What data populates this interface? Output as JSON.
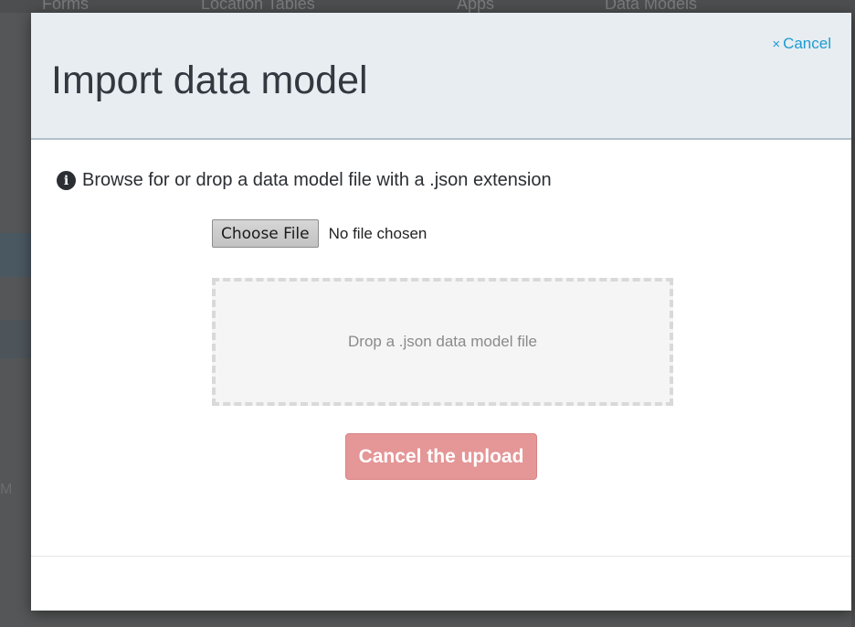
{
  "background": {
    "nav_items": [
      "Forms",
      "Location Tables",
      "Apps",
      "Data Models"
    ],
    "side_text": "M"
  },
  "modal": {
    "title": "Import data model",
    "close_label": "Cancel",
    "close_glyph": "×",
    "info_icon": "info-circle-icon",
    "info_text": "Browse for or drop a data model file with a .json extension",
    "file_input": {
      "button_label": "Choose File",
      "status": "No file chosen"
    },
    "dropzone_text": "Drop a .json data model file",
    "cancel_upload_label": "Cancel the upload"
  },
  "colors": {
    "header_bg": "#e8edf1",
    "link": "#1c9bd1",
    "danger_button": "#e59697"
  }
}
